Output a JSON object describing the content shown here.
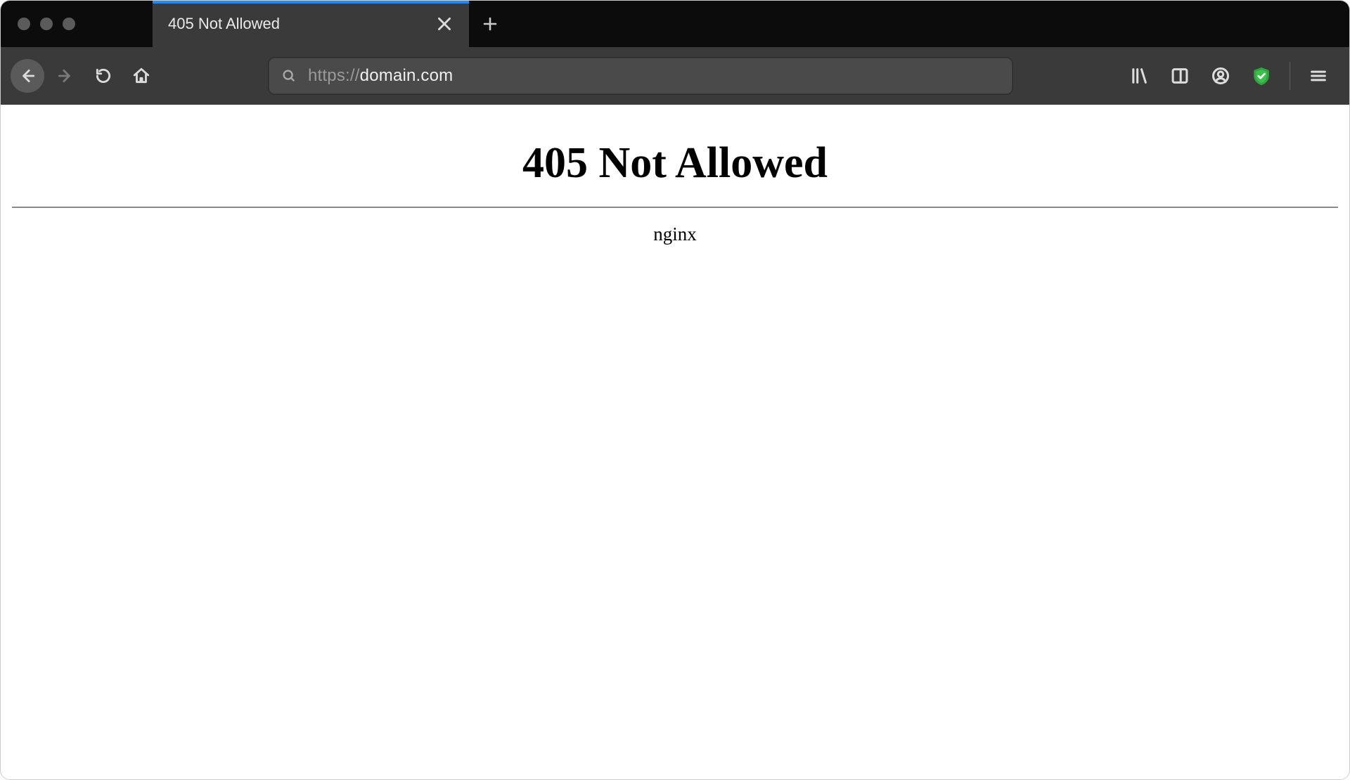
{
  "tab": {
    "title": "405 Not Allowed"
  },
  "urlbar": {
    "protocol": "https://",
    "domain": "domain.com"
  },
  "page": {
    "heading": "405 Not Allowed",
    "server": "nginx"
  }
}
